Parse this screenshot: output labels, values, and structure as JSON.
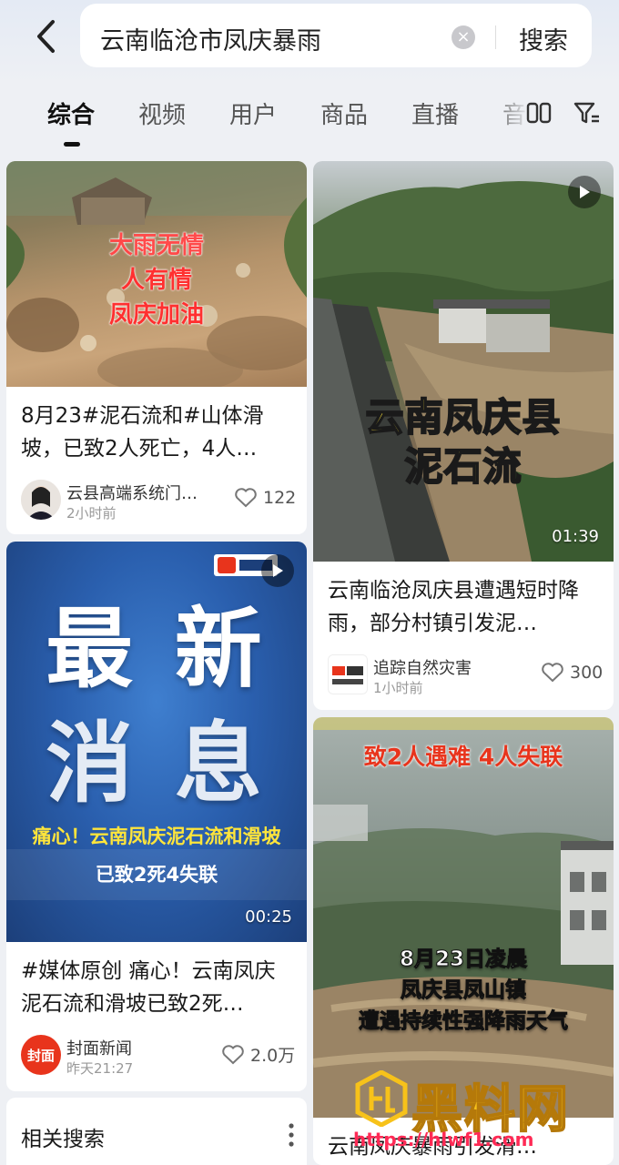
{
  "search": {
    "query": "云南临沧市凤庆暴雨",
    "button_label": "搜索"
  },
  "tabs": [
    {
      "label": "综合",
      "active": true
    },
    {
      "label": "视频"
    },
    {
      "label": "用户"
    },
    {
      "label": "商品"
    },
    {
      "label": "直播"
    },
    {
      "label": "音"
    }
  ],
  "cards": [
    {
      "overlay": [
        "大雨无情",
        "人有情",
        "凤庆加油"
      ],
      "title": "8月23#泥石流和#山体滑坡，已致2人死亡，4人…",
      "author": "云县高端系统门…",
      "time": "2小时前",
      "likes": "122"
    },
    {
      "overlay": [
        "云南凤庆县",
        "泥石流"
      ],
      "duration": "01:39",
      "title": "云南临沧凤庆县遭遇短时降雨，部分村镇引发泥…",
      "author": "追踪自然灾害",
      "time": "1小时前",
      "likes": "300"
    },
    {
      "overlay_big": [
        "最 新",
        "消 息"
      ],
      "overlay_caption": "痛心！云南凤庆泥石流和滑坡",
      "overlay_caption2": "已致2死4失联",
      "duration": "00:25",
      "title": "#媒体原创 痛心！云南凤庆泥石流和滑坡已致2死…",
      "author": "封面新闻",
      "avatar_text": "封面",
      "time": "昨天21:27",
      "likes": "2.0万"
    },
    {
      "overlay_top": "致2人遇难 4人失联",
      "overlay_lines": [
        "8月23日凌晨",
        "凤庆县凤山镇",
        "遭遇持续性强降雨天气"
      ],
      "title": "云南凤庆暴雨引发滑…"
    }
  ],
  "related": {
    "title": "相关搜索"
  },
  "watermark": {
    "text": "黑料网",
    "url": "https://hlwf1.com"
  },
  "colors": {
    "accent_red": "#e8341c",
    "yellow_text": "#ffe53b",
    "watermark_yellow": "#f7c21a"
  }
}
